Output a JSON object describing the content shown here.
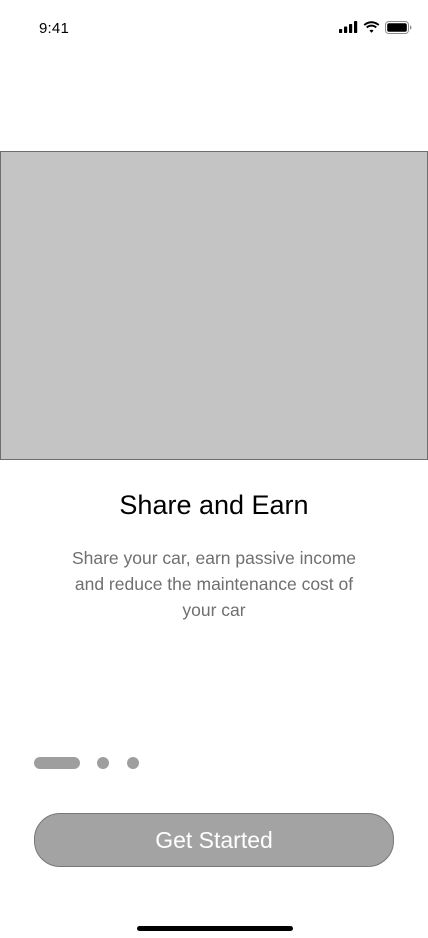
{
  "status_bar": {
    "time": "9:41",
    "icons": [
      "cellular-signal-icon",
      "wifi-icon",
      "battery-icon"
    ]
  },
  "onboarding": {
    "title": "Share and Earn",
    "subtitle": "Share your car, earn passive income and reduce the maintenance cost of your car",
    "pagination": {
      "total": 3,
      "active_index": 0
    },
    "cta_label": "Get Started"
  },
  "colors": {
    "placeholder_fill": "#c4c4c4",
    "subtitle_text": "#6f6f6f",
    "indicator": "#9e9e9e",
    "button_fill": "#a3a3a3",
    "button_text": "#ffffff"
  }
}
